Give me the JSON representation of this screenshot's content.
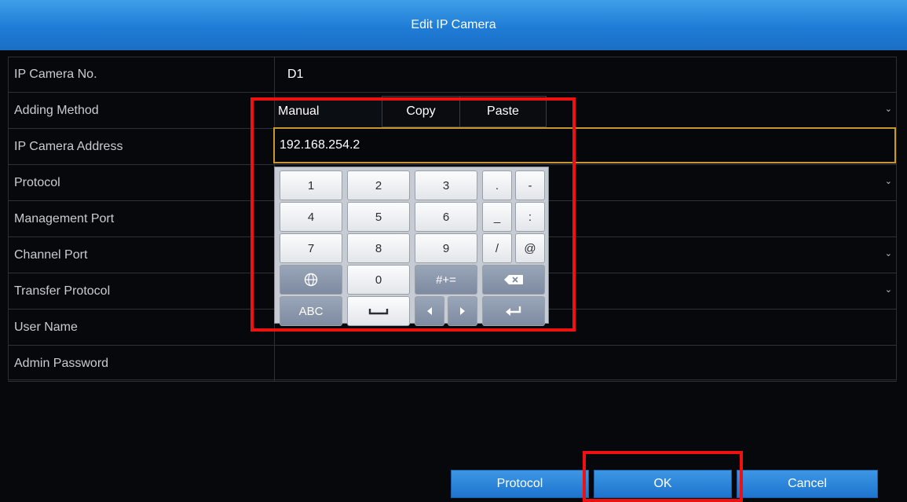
{
  "dialog": {
    "title": "Edit IP Camera"
  },
  "fields": [
    {
      "label": "IP Camera No.",
      "value": "D1",
      "dropdown": false
    },
    {
      "label": "Adding Method",
      "value": "",
      "dropdown": true
    },
    {
      "label": "IP Camera Address",
      "value": "",
      "dropdown": false
    },
    {
      "label": "Protocol",
      "value": "",
      "dropdown": true
    },
    {
      "label": "Management Port",
      "value": "",
      "dropdown": false
    },
    {
      "label": "Channel Port",
      "value": "",
      "dropdown": true
    },
    {
      "label": "Transfer Protocol",
      "value": "",
      "dropdown": true
    },
    {
      "label": "User Name",
      "value": "",
      "dropdown": false
    },
    {
      "label": "Admin Password",
      "value": "",
      "dropdown": false
    }
  ],
  "adding_method": {
    "selected": "Manual",
    "copy_label": "Copy",
    "paste_label": "Paste"
  },
  "address_input": {
    "value": "192.168.254.2"
  },
  "keypad": {
    "row1": [
      "1",
      "2",
      "3",
      ".",
      "-"
    ],
    "row2": [
      "4",
      "5",
      "6",
      "_",
      ":"
    ],
    "row3": [
      "7",
      "8",
      "9",
      "/",
      "@"
    ],
    "row4": {
      "globe": "globe-icon",
      "zero": "0",
      "symbols": "#+=",
      "backspace": "backspace-icon"
    },
    "row5": {
      "abc": "ABC",
      "space": "space-icon",
      "arrows": "arrow-keys",
      "enter": "enter-icon"
    }
  },
  "buttons": {
    "protocol": "Protocol",
    "ok": "OK",
    "cancel": "Cancel"
  },
  "colors": {
    "title_bar": "#1f7cd6",
    "focus_border": "#c8962e",
    "highlight": "#ee1111",
    "button": "#1e74cf"
  }
}
